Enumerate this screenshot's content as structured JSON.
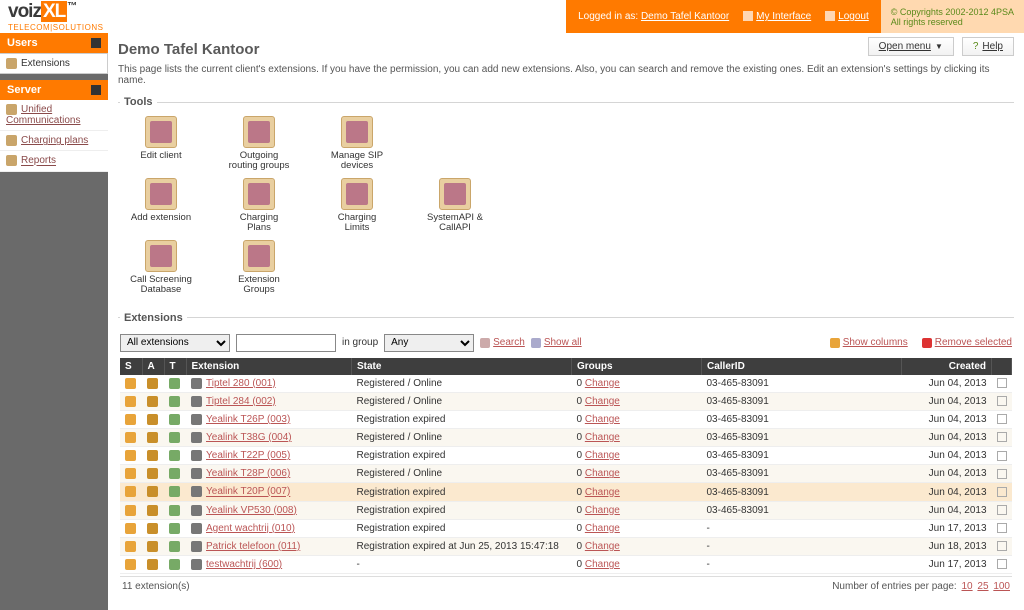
{
  "brand": {
    "name_pre": "voiz",
    "name_hl": "XL",
    "sub": "TELECOM|SOLUTIONS"
  },
  "topbar": {
    "login_prefix": "Logged in as:",
    "login_name": "Demo Tafel Kantoor",
    "my_interface": "My Interface",
    "logout": "Logout",
    "copyright": "© Copyrights 2002-2012 4PSA",
    "rights": "All rights reserved"
  },
  "sidebar": {
    "section1": "Users",
    "items1": {
      "extensions": "Extensions"
    },
    "section2": "Server",
    "items2": {
      "unified": "Unified Communications",
      "charging": "Charging plans",
      "reports": "Reports"
    }
  },
  "page": {
    "title": "Demo Tafel Kantoor",
    "desc": "This page lists the current client's extensions. If you have the permission, you can add new extensions. Also, you can search and remove the existing ones. Edit an extension's settings by clicking its name.",
    "open_menu": "Open menu",
    "help": "Help"
  },
  "tools_legend": "Tools",
  "tools": {
    "edit_client": "Edit client",
    "outgoing": "Outgoing routing groups",
    "sip": "Manage SIP devices",
    "add_ext": "Add extension",
    "charging_plans": "Charging Plans",
    "charging_limits": "Charging Limits",
    "api": "SystemAPI & CallAPI",
    "screening": "Call Screening Database",
    "ext_groups": "Extension Groups"
  },
  "ext_legend": "Extensions",
  "filter": {
    "all_ext": "All extensions",
    "in_group": "in group",
    "any": "Any",
    "search": "Search",
    "show_all": "Show all",
    "show_cols": "Show columns",
    "remove_sel": "Remove selected"
  },
  "table": {
    "headers": {
      "s": "S",
      "a": "A",
      "t": "T",
      "ext": "Extension",
      "state": "State",
      "groups": "Groups",
      "caller": "CallerID",
      "created": "Created"
    },
    "rows": [
      {
        "name": "Tiptel 280 (001)",
        "state": "Registered / Online",
        "g": "0",
        "change": "Change",
        "cid": "03-465-83091",
        "created": "Jun 04, 2013"
      },
      {
        "name": "Tiptel 284 (002)",
        "state": "Registered / Online",
        "g": "0",
        "change": "Change",
        "cid": "03-465-83091",
        "created": "Jun 04, 2013"
      },
      {
        "name": "Yealink T26P (003)",
        "state": "Registration expired",
        "g": "0",
        "change": "Change",
        "cid": "03-465-83091",
        "created": "Jun 04, 2013"
      },
      {
        "name": "Yealink T38G (004)",
        "state": "Registered / Online",
        "g": "0",
        "change": "Change",
        "cid": "03-465-83091",
        "created": "Jun 04, 2013"
      },
      {
        "name": "Yealink T22P (005)",
        "state": "Registration expired",
        "g": "0",
        "change": "Change",
        "cid": "03-465-83091",
        "created": "Jun 04, 2013"
      },
      {
        "name": "Yealink T28P (006)",
        "state": "Registered / Online",
        "g": "0",
        "change": "Change",
        "cid": "03-465-83091",
        "created": "Jun 04, 2013"
      },
      {
        "name": "Yealink T20P (007)",
        "state": "Registration expired",
        "g": "0",
        "change": "Change",
        "cid": "03-465-83091",
        "created": "Jun 04, 2013",
        "sel": true
      },
      {
        "name": "Yealink VP530 (008)",
        "state": "Registration expired",
        "g": "0",
        "change": "Change",
        "cid": "03-465-83091",
        "created": "Jun 04, 2013"
      },
      {
        "name": "Agent wachtrij (010)",
        "state": "Registration expired",
        "g": "0",
        "change": "Change",
        "cid": "-",
        "created": "Jun 17, 2013"
      },
      {
        "name": "Patrick telefoon (011)",
        "state": "Registration expired at Jun 25, 2013 15:47:18",
        "g": "0",
        "change": "Change",
        "cid": "-",
        "created": "Jun 18, 2013"
      },
      {
        "name": "testwachtrij (600)",
        "state": "-",
        "g": "0",
        "change": "Change",
        "cid": "-",
        "created": "Jun 17, 2013"
      }
    ]
  },
  "footer": {
    "count": "11 extension(s)",
    "perpage_label": "Number of entries per page:",
    "opts": [
      "10",
      "25",
      "100"
    ]
  }
}
